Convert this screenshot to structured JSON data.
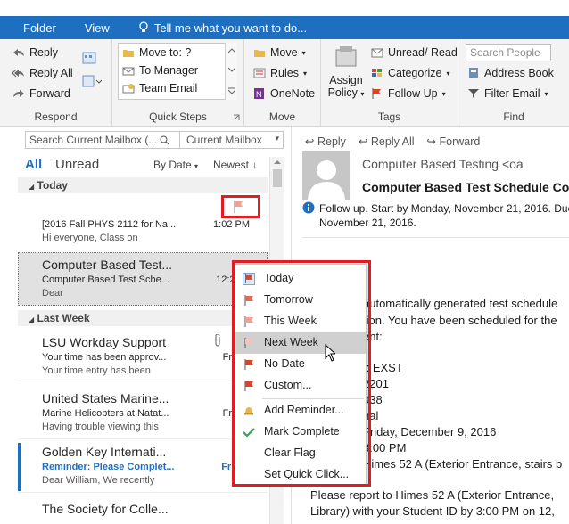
{
  "ribbon_tabs": [
    "Folder",
    "View"
  ],
  "tell_me": "Tell me what you want to do...",
  "respond": {
    "reply": "Reply",
    "reply_all": "Reply All",
    "forward": "Forward",
    "label": "Respond"
  },
  "quick_steps": {
    "items": [
      "Move to: ?",
      "To Manager",
      "Team Email"
    ],
    "label": "Quick Steps"
  },
  "move": {
    "move": "Move",
    "rules": "Rules",
    "onenote": "OneNote",
    "label": "Move"
  },
  "tags": {
    "assign_policy_1": "Assign",
    "assign_policy_2": "Policy",
    "unread_read": "Unread/ Read",
    "categorize": "Categorize",
    "follow_up": "Follow Up",
    "label": "Tags"
  },
  "find": {
    "search_people": "Search People",
    "address_book": "Address Book",
    "filter_email": "Filter Email",
    "label": "Find"
  },
  "list": {
    "search_placeholder": "Search Current Mailbox (...",
    "scope": "Current Mailbox",
    "all": "All",
    "unread": "Unread",
    "by_date": "By Date",
    "newest": "Newest",
    "today_header": "Today",
    "last_week_header": "Last Week"
  },
  "messages": [
    {
      "sender": "",
      "subject": "[2016 Fall PHYS 2112 for Na...",
      "time": "1:02 PM",
      "preview": "Hi everyone,  Class on"
    },
    {
      "sender": "Computer Based Test...",
      "subject": "Computer Based Test Sche...",
      "time": "12:27 P",
      "preview": "Dear"
    },
    {
      "sender": "LSU Workday Support",
      "subject": "Your time has been approv...",
      "time": "Fri 11/",
      "preview": "Your time entry has been"
    },
    {
      "sender": "United States Marine...",
      "subject": "Marine Helicopters at Natat...",
      "time": "Fri 11/",
      "preview": "Having trouble viewing this"
    },
    {
      "sender": "Golden Key Internati...",
      "subject": "Reminder: Please Complet...",
      "time": "Fri 11/",
      "preview": "Dear William,  We recently"
    },
    {
      "sender": "The Society for Colle...",
      "subject": "",
      "time": "",
      "preview": ""
    }
  ],
  "flag_menu": {
    "items": [
      "Today",
      "Tomorrow",
      "This Week",
      "Next Week",
      "No Date",
      "Custom...",
      "Add Reminder...",
      "Mark Complete",
      "Clear Flag",
      "Set Quick Click..."
    ],
    "active": "Next Week"
  },
  "reading": {
    "reply": "Reply",
    "reply_all": "Reply All",
    "forward": "Forward",
    "from": "Computer Based Testing <oa",
    "subject": "Computer Based Test Schedule Co",
    "follow_up": "Follow up.  Start by Monday, November 21, 2016.  Due by",
    "follow_up_2": "November 21, 2016.",
    "body_lines": [
      "automatically generated test schedule",
      "tion.  You have been scheduled for the",
      "ent:",
      "t:  EXST",
      "2201",
      "038",
      "nal",
      "Friday, December 9, 2016",
      "3:00 PM",
      "Himes 52 A (Exterior Entrance, stairs b",
      "Please report to Himes 52 A (Exterior Entrance,",
      "Library) with your Student ID by 3:00 PM on 12,"
    ]
  },
  "colors": {
    "ribbon_blue": "#1f6fc1",
    "flag_red": "#d9442b",
    "flag_light": "#f0a18f",
    "annotation_red": "#e01d24",
    "link_blue": "#1f6fc1"
  }
}
